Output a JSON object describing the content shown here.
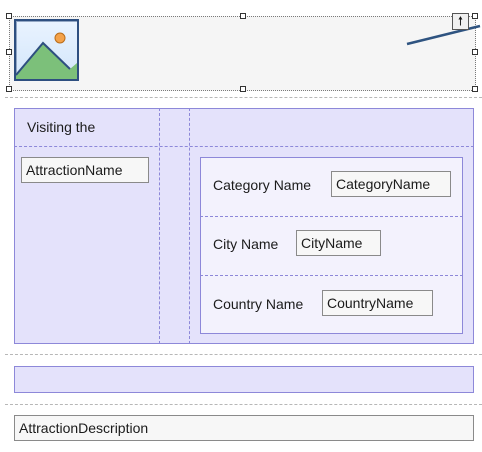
{
  "toolbar": {
    "move_up_icon": "arrow-up-icon"
  },
  "image": {
    "icon": "image-placeholder-icon"
  },
  "main": {
    "header_text": "Visiting the",
    "attraction_name_field": "AttractionName",
    "details": {
      "category": {
        "label": "Category Name",
        "value": "CategoryName"
      },
      "city": {
        "label": "City Name",
        "value": "CityName"
      },
      "country": {
        "label": "Country Name",
        "value": "CountryName"
      }
    }
  },
  "description_field": "AttractionDescription"
}
